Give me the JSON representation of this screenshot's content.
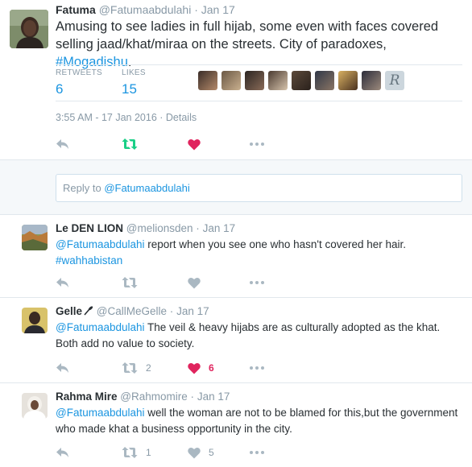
{
  "main_tweet": {
    "fullname": "Fatuma",
    "screen_name": "@Fatumaabdulahi",
    "dot": "·",
    "time": "Jan 17",
    "text": "Amusing to see ladies in full hijab, some even with faces covered selling jaad/khat/miraa on the streets. City of paradoxes, ",
    "hashtag": "#Mogadishu",
    "text_end": ".",
    "stats": {
      "retweets_label": "RETWEETS",
      "retweets_value": "6",
      "likes_label": "LIKES",
      "likes_value": "15"
    },
    "liker_badge": "R",
    "timestamp": "3:55 AM - 17 Jan 2016",
    "timestamp_sep": " · ",
    "details_label": "Details",
    "liked": true
  },
  "reply_box": {
    "prefix": "Reply to ",
    "mention": "@Fatumaabdulahi"
  },
  "replies": [
    {
      "fullname": "Le DEN LION",
      "screen_name": "@melionsden",
      "dot": "·",
      "time": "Jan 17",
      "mention": "@Fatumaabdulahi",
      "text": " report when you see one who hasn't covered her hair.",
      "hashtag": "#wahhabistan",
      "retweets": "",
      "likes": ""
    },
    {
      "fullname": "Gelle",
      "screen_name": "@CallMeGelle",
      "dot": "·",
      "time": "Jan 17",
      "mention": "@Fatumaabdulahi",
      "text": " The veil & heavy hijabs are as culturally adopted as the khat. Both add no value to society.",
      "retweets": "2",
      "likes": "6"
    },
    {
      "fullname": "Rahma Mire",
      "screen_name": "@Rahmomire",
      "dot": "·",
      "time": "Jan 17",
      "mention": "@Fatumaabdulahi",
      "text": " well the woman are not to be blamed for this,but the government who made khat a  business opportunity in the city.",
      "retweets": "1",
      "likes": "5"
    }
  ],
  "colors": {
    "link": "#1b95e0",
    "muted": "#8899a6",
    "retweet_green": "#19cf86",
    "like_red": "#e0245e",
    "icon_grey": "#aab8c2"
  }
}
